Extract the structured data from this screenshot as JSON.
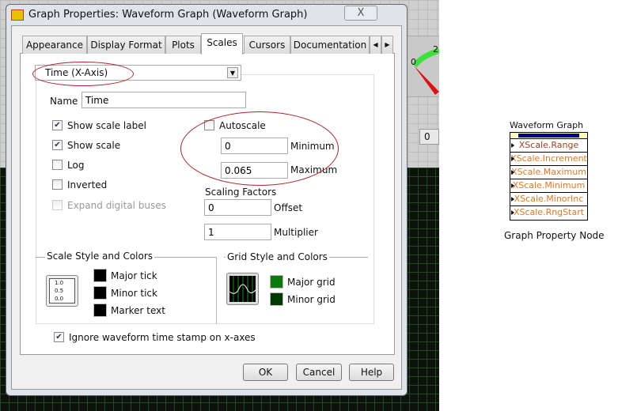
{
  "dialog": {
    "title": "Graph Properties: Waveform Graph (Waveform Graph)",
    "close": "X",
    "tabs": [
      "Appearance",
      "Display Format",
      "Plots",
      "Scales",
      "Cursors",
      "Documentation"
    ],
    "selected_tab": "Scales",
    "axis_select": "Time (X-Axis)",
    "name_label": "Name",
    "name_value": "Time",
    "checkboxes": [
      {
        "label": "Show scale label",
        "checked": true
      },
      {
        "label": "Show scale",
        "checked": true
      },
      {
        "label": "Log",
        "checked": false
      },
      {
        "label": "Inverted",
        "checked": false
      },
      {
        "label": "Expand digital buses",
        "checked": false,
        "disabled": true
      }
    ],
    "autoscale": {
      "label": "Autoscale",
      "checked": false
    },
    "minimum": {
      "label": "Minimum",
      "value": "0"
    },
    "maximum": {
      "label": "Maximum",
      "value": "0.065"
    },
    "scaling_factors": {
      "title": "Scaling Factors",
      "offset_label": "Offset",
      "offset": "0",
      "multiplier_label": "Multiplier",
      "multiplier": "1"
    },
    "scale_style": {
      "title": "Scale Style and Colors",
      "ticks": [
        "1.0",
        "0.5",
        "0.0"
      ],
      "colors": [
        {
          "label": "Major tick",
          "color": "#000000"
        },
        {
          "label": "Minor tick",
          "color": "#000000"
        },
        {
          "label": "Marker text",
          "color": "#000000"
        }
      ]
    },
    "grid_style": {
      "title": "Grid Style and Colors",
      "colors": [
        {
          "label": "Major grid",
          "color": "#0a7a0a"
        },
        {
          "label": "Minor grid",
          "color": "#003a00"
        }
      ]
    },
    "ignore_timestamp": {
      "label": "Ignore waveform time stamp on x-axes",
      "checked": true
    },
    "buttons": {
      "ok": "OK",
      "cancel": "Cancel",
      "help": "Help"
    }
  },
  "background": {
    "gauge_labels": [
      "0",
      "2"
    ],
    "numeric_value": "0"
  },
  "property_node": {
    "title": "Waveform Graph",
    "properties": [
      "XScale.Range",
      "XScale.Increment",
      "XScale.Maximum",
      "XScale.Minimum",
      "XScale.MinorInc",
      "XScale.RngStart"
    ],
    "caption": "Graph Property Node",
    "text_color": "#e07820"
  }
}
